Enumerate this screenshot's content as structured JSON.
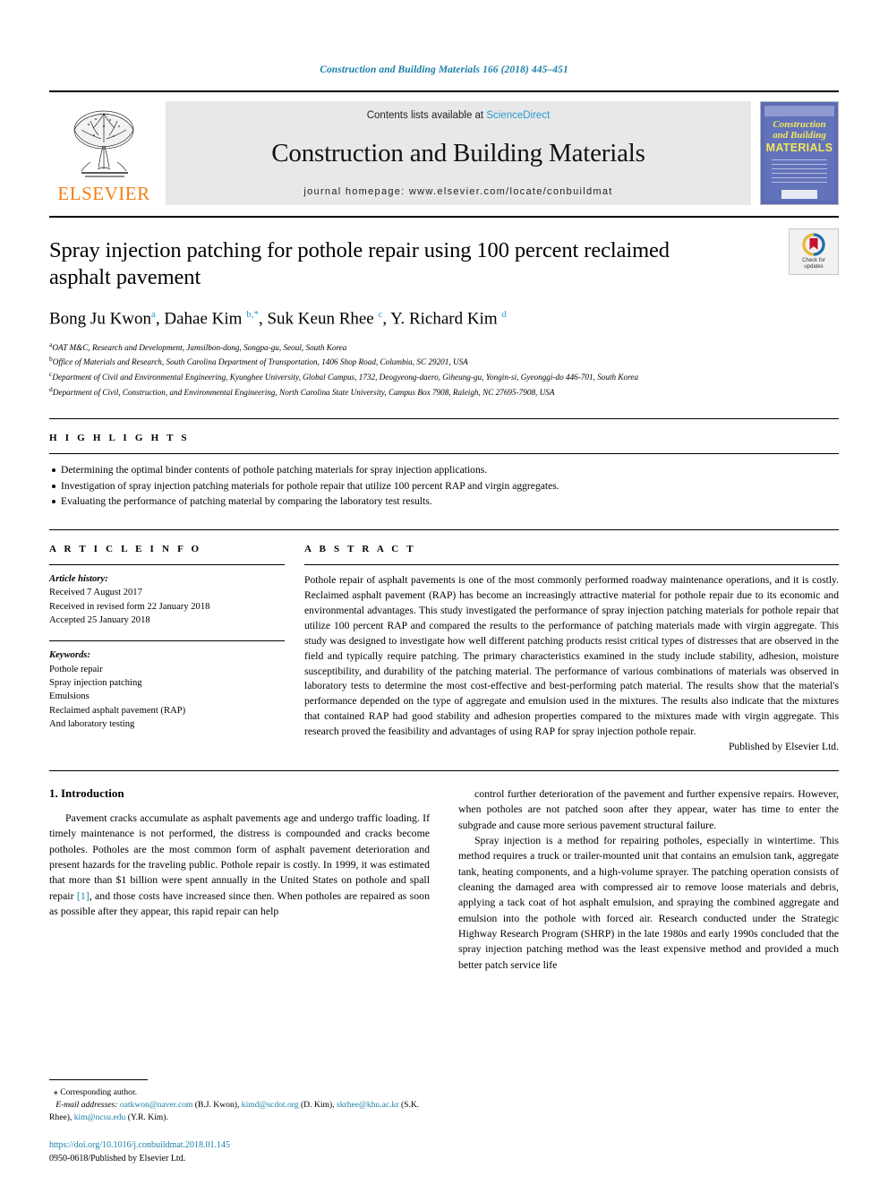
{
  "running_head": "Construction and Building Materials 166 (2018) 445–451",
  "masthead": {
    "publisher_name": "ELSEVIER",
    "contents_prefix": "Contents lists available at ",
    "contents_link": "ScienceDirect",
    "journal_title": "Construction and Building Materials",
    "homepage": "journal homepage: www.elsevier.com/locate/conbuildmat",
    "cover": {
      "line1": "Construction",
      "line2": "and Building",
      "line3": "MATERIALS"
    }
  },
  "article": {
    "title": "Spray injection patching for pothole repair using 100 percent reclaimed asphalt pavement",
    "authors_html": "Bong Ju Kwon<sup>a</sup>, Dahae Kim <sup>b,*</sup>, Suk Keun Rhee <sup>c</sup>, Y. Richard Kim <sup>d</sup>",
    "affiliations": [
      "OAT M&C, Research and Development, Jamsilbon-dong, Songpa-gu, Seoul, South Korea",
      "Office of Materials and Research, South Carolina Department of Transportation, 1406 Shop Road, Columbia, SC 29201, USA",
      "Department of Civil and Environmental Engineering, Kyunghee University, Global Campus, 1732, Deogyeong-daero, Giheung-gu, Yongin-si, Gyeonggi-do 446-701, South Korea",
      "Department of Civil, Construction, and Environmental Engineering, North Carolina State University, Campus Box 7908, Raleigh, NC 27695-7908, USA"
    ],
    "affiliation_markers": [
      "a",
      "b",
      "c",
      "d"
    ],
    "crossmark_label_line1": "Check for",
    "crossmark_label_line2": "updates"
  },
  "highlights": {
    "heading": "H I G H L I G H T S",
    "items": [
      "Determining the optimal binder contents of pothole patching materials for spray injection applications.",
      "Investigation of spray injection patching materials for pothole repair that utilize 100 percent RAP and virgin aggregates.",
      "Evaluating the performance of patching material by comparing the laboratory test results."
    ]
  },
  "article_info": {
    "heading": "A R T I C L E    I N F O",
    "history_label": "Article history:",
    "history": [
      "Received 7 August 2017",
      "Received in revised form 22 January 2018",
      "Accepted 25 January 2018"
    ],
    "keywords_label": "Keywords:",
    "keywords": [
      "Pothole repair",
      "Spray injection patching",
      "Emulsions",
      "Reclaimed asphalt pavement (RAP)",
      "And laboratory testing"
    ]
  },
  "abstract": {
    "heading": "A B S T R A C T",
    "text": "Pothole repair of asphalt pavements is one of the most commonly performed roadway maintenance operations, and it is costly. Reclaimed asphalt pavement (RAP) has become an increasingly attractive material for pothole repair due to its economic and environmental advantages. This study investigated the performance of spray injection patching materials for pothole repair that utilize 100 percent RAP and compared the results to the performance of patching materials made with virgin aggregate. This study was designed to investigate how well different patching products resist critical types of distresses that are observed in the field and typically require patching. The primary characteristics examined in the study include stability, adhesion, moisture susceptibility, and durability of the patching material. The performance of various combinations of materials was observed in laboratory tests to determine the most cost-effective and best-performing patch material. The results show that the material's performance depended on the type of aggregate and emulsion used in the mixtures. The results also indicate that the mixtures that contained RAP had good stability and adhesion properties compared to the mixtures made with virgin aggregate. This research proved the feasibility and advantages of using RAP for spray injection pothole repair.",
    "published_by": "Published by Elsevier Ltd."
  },
  "body": {
    "section_title": "1. Introduction",
    "left_p1_a": "Pavement cracks accumulate as asphalt pavements age and undergo traffic loading. If timely maintenance is not performed, the distress is compounded and cracks become potholes. Potholes are the most common form of asphalt pavement deterioration and present hazards for the traveling public. Pothole repair is costly. In 1999, it was estimated that more than $1 billion were spent annually in the United States on pothole and spall repair ",
    "left_p1_ref": "[1]",
    "left_p1_b": ", and those costs have increased since then. When potholes are repaired as soon as possible after they appear, this rapid repair can help",
    "right_p1": "control further deterioration of the pavement and further expensive repairs. However, when potholes are not patched soon after they appear, water has time to enter the subgrade and cause more serious pavement structural failure.",
    "right_p2": "Spray injection is a method for repairing potholes, especially in wintertime. This method requires a truck or trailer-mounted unit that contains an emulsion tank, aggregate tank, heating components, and a high-volume sprayer. The patching operation consists of cleaning the damaged area with compressed air to remove loose materials and debris, applying a tack coat of hot asphalt emulsion, and spraying the combined aggregate and emulsion into the pothole with forced air. Research conducted under the Strategic Highway Research Program (SHRP) in the late 1980s and early 1990s concluded that the spray injection patching method was the least expensive method and provided a much better patch service life"
  },
  "footnotes": {
    "corresponding_marker": "⁎",
    "corresponding_text": "Corresponding author.",
    "email_label": "E-mail addresses:",
    "emails": [
      {
        "address": "oatkwon@naver.com",
        "owner": "(B.J. Kwon)"
      },
      {
        "address": "kimd@scdot.org",
        "owner": "(D. Kim)"
      },
      {
        "address": "skrhee@khu.ac.kr",
        "owner": "(S.K. Rhee)"
      },
      {
        "address": "kim@ncsu.edu",
        "owner": "(Y.R. Kim)"
      }
    ],
    "doi": "https://doi.org/10.1016/j.conbuildmat.2018.01.145",
    "issn_line": "0950-0618/Published by Elsevier Ltd."
  },
  "colors": {
    "link_blue": "#1a7fa8",
    "sciencedirect_blue": "#2a9ad0",
    "elsevier_orange": "#f07f13",
    "cover_blue": "#5b6bb5",
    "cover_yellow": "#f2e85a"
  }
}
